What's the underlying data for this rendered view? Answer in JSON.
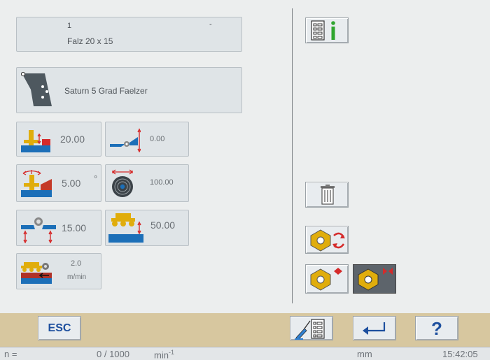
{
  "program": {
    "number": "1",
    "name": "Falz 20 x 15",
    "marker": "-"
  },
  "tool": {
    "name": "Saturn 5 Grad Faelzer"
  },
  "params": {
    "p1": {
      "value": "20.00",
      "icon": "vertical-spindle-height-icon"
    },
    "p2": {
      "value": "0.00",
      "icon": "fence-offset-icon"
    },
    "p3": {
      "value": "5.00",
      "unit": "°",
      "icon": "tilt-angle-icon"
    },
    "p4": {
      "value": "100.00",
      "icon": "tool-diameter-icon"
    },
    "p5": {
      "value": "15.00",
      "icon": "fence-opening-icon"
    },
    "p6": {
      "value": "50.00",
      "icon": "feed-roller-height-icon"
    },
    "p7": {
      "value": "2.0",
      "unit": "m/min",
      "icon": "feed-speed-icon"
    }
  },
  "bottom_bar": {
    "esc_label": "ESC",
    "help_label": "?"
  },
  "status_bar": {
    "n_label": "n =",
    "count": "0 / 1000",
    "rpm_unit": "min",
    "rpm_exp": "-1",
    "length_unit": "mm",
    "time": "15:42:05"
  },
  "colors": {
    "gold": "#e0ad0c",
    "red": "#d52b2b",
    "blue": "#1c6fb8",
    "bottom_bar": "#d7c79f"
  }
}
